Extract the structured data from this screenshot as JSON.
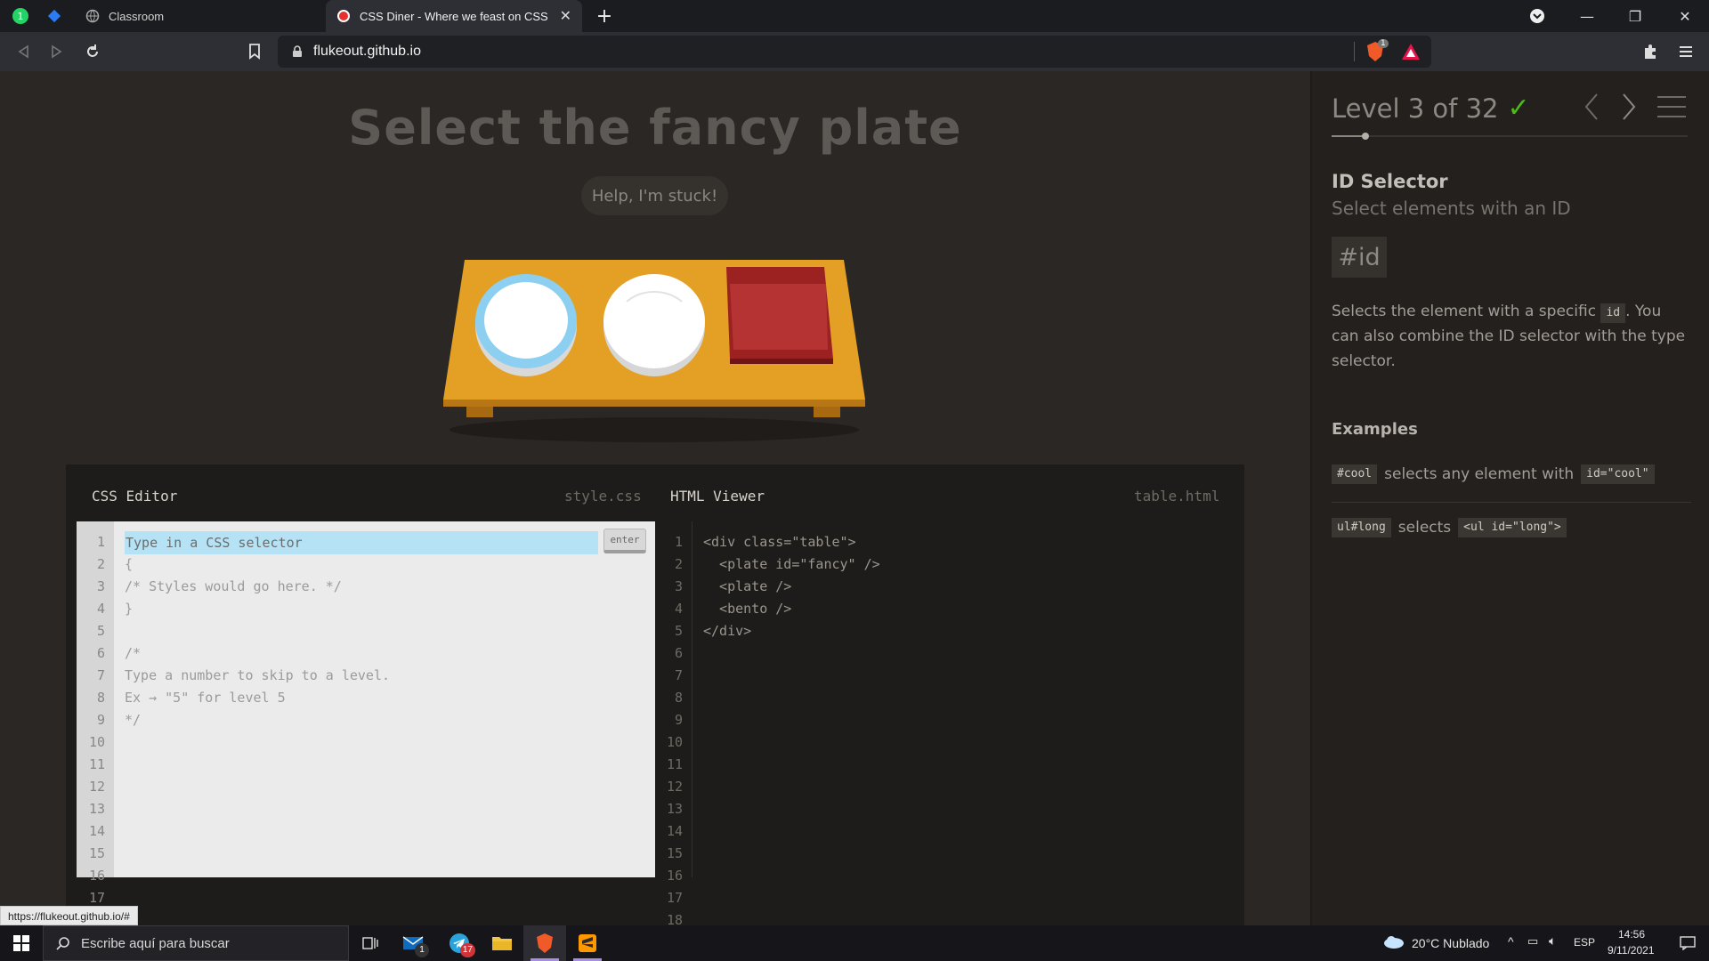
{
  "browser": {
    "tabs": [
      {
        "title": "Classroom",
        "active": false
      },
      {
        "title": "CSS Diner - Where we feast on CSS Selectors!",
        "active": true
      }
    ],
    "url": "flukeout.github.io",
    "shield_badge": "1",
    "status_link": "https://flukeout.github.io/#"
  },
  "game": {
    "title": "Select the fancy plate",
    "help_label": "Help, I'm stuck!",
    "css_editor": {
      "title": "CSS Editor",
      "filename": "style.css",
      "placeholder": "Type in a CSS selector",
      "enter_label": "enter",
      "lines": [
        "{",
        "/* Styles would go here. */",
        "}",
        "",
        "/*",
        "Type a number to skip to a level.",
        "Ex → \"5\" for level 5",
        "*/"
      ],
      "line_numbers": [
        "1",
        "2",
        "3",
        "4",
        "5",
        "6",
        "7",
        "8",
        "9",
        "10",
        "11",
        "12",
        "13",
        "14",
        "15",
        "16",
        "17"
      ]
    },
    "html_viewer": {
      "title": "HTML Viewer",
      "filename": "table.html",
      "lines": [
        "<div class=\"table\">",
        "  <plate id=\"fancy\" />",
        "  <plate />",
        "  <bento />",
        "</div>"
      ],
      "line_numbers": [
        "1",
        "2",
        "3",
        "4",
        "5",
        "6",
        "7",
        "8",
        "9",
        "10",
        "11",
        "12",
        "13",
        "14",
        "15",
        "16",
        "17",
        "18"
      ]
    }
  },
  "sidebar": {
    "level_label": "Level 3 of 32",
    "completed": true,
    "progress": 0.094,
    "selector_name": "ID Selector",
    "selector_title": "Select elements with an ID",
    "syntax": "#id",
    "hint_before": "Selects the element with a specific ",
    "hint_code": "id",
    "hint_after": ". You can also combine the ID selector with the type selector.",
    "examples_title": "Examples",
    "examples": [
      {
        "code": "#cool",
        "text": "selects any element with",
        "code2": "id=\"cool\""
      },
      {
        "code": "ul#long",
        "text": "selects",
        "code2": "<ul id=\"long\">"
      }
    ]
  },
  "taskbar": {
    "search_placeholder": "Escribe aquí para buscar",
    "mail_badge": "1",
    "telegram_badge": "17",
    "weather": "20°C  Nublado",
    "language": "ESP",
    "time": "14:56",
    "date": "9/11/2021"
  },
  "colors": {
    "accent_check": "#4cbb17",
    "input_highlight": "#b5e3f5",
    "table_wood": "#e3a024",
    "bento_red": "#b43232",
    "fancy_plate_ring": "#8ccff0"
  }
}
